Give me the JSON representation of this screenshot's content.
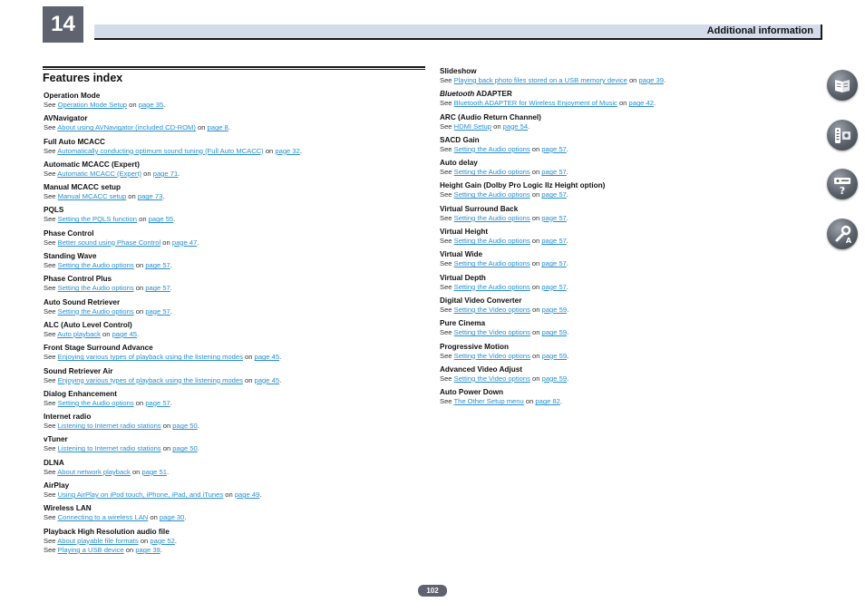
{
  "header": {
    "chapter": "14",
    "title": "Additional information"
  },
  "section_title": "Features index",
  "left_column": [
    {
      "title": "Operation Mode",
      "lines": [
        {
          "pre": "See ",
          "link": "Operation Mode Setup",
          "mid": " on ",
          "page": "page 35",
          "post": "."
        }
      ]
    },
    {
      "title": "AVNavigator",
      "lines": [
        {
          "pre": "See ",
          "link": "About using AVNavigator (included CD-ROM)",
          "mid": " on ",
          "page": "page 8",
          "post": "."
        }
      ]
    },
    {
      "title": "Full Auto MCACC",
      "lines": [
        {
          "pre": "See ",
          "link": "Automatically conducting optimum sound tuning (Full Auto MCACC)",
          "mid": " on ",
          "page": "page 32",
          "post": "."
        }
      ]
    },
    {
      "title": "Automatic MCACC (Expert)",
      "lines": [
        {
          "pre": "See ",
          "link": "Automatic MCACC (Expert)",
          "mid": " on ",
          "page": "page 71",
          "post": "."
        }
      ]
    },
    {
      "title": "Manual MCACC setup",
      "lines": [
        {
          "pre": "See ",
          "link": "Manual MCACC setup",
          "mid": " on ",
          "page": "page 73",
          "post": "."
        }
      ]
    },
    {
      "title": "PQLS",
      "lines": [
        {
          "pre": "See ",
          "link": "Setting the PQLS function",
          "mid": " on ",
          "page": "page 55",
          "post": "."
        }
      ]
    },
    {
      "title": "Phase Control",
      "lines": [
        {
          "pre": "See ",
          "link": "Better sound using Phase Control",
          "mid": " on ",
          "page": "page 47",
          "post": "."
        }
      ]
    },
    {
      "title": "Standing Wave",
      "lines": [
        {
          "pre": "See ",
          "link": "Setting the Audio options",
          "mid": " on ",
          "page": "page 57",
          "post": "."
        }
      ]
    },
    {
      "title": "Phase Control Plus",
      "lines": [
        {
          "pre": "See ",
          "link": "Setting the Audio options",
          "mid": " on ",
          "page": "page 57",
          "post": "."
        }
      ]
    },
    {
      "title": "Auto Sound Retriever",
      "lines": [
        {
          "pre": "See ",
          "link": "Setting the Audio options",
          "mid": " on ",
          "page": "page 57",
          "post": "."
        }
      ]
    },
    {
      "title": "ALC (Auto Level Control)",
      "lines": [
        {
          "pre": "See ",
          "link": "Auto playback",
          "mid": " on ",
          "page": "page 45",
          "post": "."
        }
      ]
    },
    {
      "title": "Front Stage Surround Advance",
      "lines": [
        {
          "pre": "See ",
          "link": "Enjoying various types of playback using the listening modes",
          "mid": " on ",
          "page": "page 45",
          "post": "."
        }
      ]
    },
    {
      "title": "Sound Retriever Air",
      "lines": [
        {
          "pre": "See ",
          "link": "Enjoying various types of playback using the listening modes",
          "mid": " on ",
          "page": "page 45",
          "post": "."
        }
      ]
    },
    {
      "title": "Dialog Enhancement",
      "lines": [
        {
          "pre": "See ",
          "link": "Setting the Audio options",
          "mid": " on ",
          "page": "page 57",
          "post": "."
        }
      ]
    },
    {
      "title": "Internet radio",
      "lines": [
        {
          "pre": "See ",
          "link": "Listening to Internet radio stations",
          "mid": " on ",
          "page": "page 50",
          "post": "."
        }
      ]
    },
    {
      "title": "vTuner",
      "lines": [
        {
          "pre": "See ",
          "link": "Listening to Internet radio stations",
          "mid": " on ",
          "page": "page 50",
          "post": "."
        }
      ]
    },
    {
      "title": "DLNA",
      "lines": [
        {
          "pre": "See ",
          "link": "About network playback",
          "mid": " on ",
          "page": "page 51",
          "post": "."
        }
      ]
    },
    {
      "title": "AirPlay",
      "lines": [
        {
          "pre": "See ",
          "link": "Using AirPlay on iPod touch, iPhone, iPad, and iTunes",
          "mid": " on ",
          "page": "page 49",
          "post": "."
        }
      ]
    },
    {
      "title": "Wireless LAN",
      "lines": [
        {
          "pre": "See ",
          "link": "Connecting to a wireless LAN",
          "mid": " on ",
          "page": "page 30",
          "post": "."
        }
      ]
    },
    {
      "title": "Playback High Resolution audio file",
      "lines": [
        {
          "pre": "See ",
          "link": "About playable file formats",
          "mid": " on ",
          "page": "page 52",
          "post": "."
        },
        {
          "pre": "See ",
          "link": "Playing a USB device",
          "mid": " on ",
          "page": "page 39",
          "post": "."
        }
      ]
    }
  ],
  "right_column": [
    {
      "title": "Slideshow",
      "lines": [
        {
          "pre": "See ",
          "link": "Playing back photo files stored on a USB memory device",
          "mid": " on ",
          "page": "page 39",
          "post": "."
        }
      ]
    },
    {
      "title_em": "Bluetooth",
      "title": " ADAPTER",
      "lines": [
        {
          "pre": "See ",
          "link": "Bluetooth ADAPTER for Wireless Enjoyment of Music",
          "mid": " on ",
          "page": "page 42",
          "post": "."
        }
      ]
    },
    {
      "title": "ARC (Audio Return Channel)",
      "lines": [
        {
          "pre": "See ",
          "link": "HDMI Setup",
          "mid": " on ",
          "page": "page 54",
          "post": "."
        }
      ]
    },
    {
      "title": "SACD Gain",
      "lines": [
        {
          "pre": "See ",
          "link": "Setting the Audio options",
          "mid": " on ",
          "page": "page 57",
          "post": "."
        }
      ]
    },
    {
      "title": "Auto delay",
      "lines": [
        {
          "pre": "See ",
          "link": "Setting the Audio options",
          "mid": " on ",
          "page": "page 57",
          "post": "."
        }
      ]
    },
    {
      "title": "Height Gain (Dolby Pro Logic llz Height option)",
      "lines": [
        {
          "pre": "See ",
          "link": "Setting the Audio options",
          "mid": " on ",
          "page": "page 57",
          "post": "."
        }
      ]
    },
    {
      "title": "Virtual Surround Back",
      "lines": [
        {
          "pre": "See ",
          "link": "Setting the Audio options",
          "mid": " on ",
          "page": "page 57",
          "post": "."
        }
      ]
    },
    {
      "title": "Virtual Height",
      "lines": [
        {
          "pre": "See ",
          "link": "Setting the Audio options",
          "mid": " on ",
          "page": "page 57",
          "post": "."
        }
      ]
    },
    {
      "title": "Virtual Wide",
      "lines": [
        {
          "pre": "See ",
          "link": "Setting the Audio options",
          "mid": " on ",
          "page": "page 57",
          "post": "."
        }
      ]
    },
    {
      "title": "Virtual Depth",
      "lines": [
        {
          "pre": "See ",
          "link": "Setting the Audio options",
          "mid": " on ",
          "page": "page 57",
          "post": "."
        }
      ]
    },
    {
      "title": "Digital Video Converter",
      "lines": [
        {
          "pre": "See ",
          "link": "Setting the Video options",
          "mid": " on ",
          "page": "page 59",
          "post": "."
        }
      ]
    },
    {
      "title": "Pure Cinema",
      "lines": [
        {
          "pre": "See ",
          "link": "Setting the Video options",
          "mid": " on ",
          "page": "page 59",
          "post": "."
        }
      ]
    },
    {
      "title": "Progressive Motion",
      "lines": [
        {
          "pre": "See ",
          "link": "Setting the Video options",
          "mid": " on ",
          "page": "page 59",
          "post": "."
        }
      ]
    },
    {
      "title": "Advanced Video Adjust",
      "lines": [
        {
          "pre": "See ",
          "link": "Setting the Video options",
          "mid": " on ",
          "page": "page 59",
          "post": "."
        }
      ]
    },
    {
      "title": "Auto Power Down",
      "lines": [
        {
          "pre": "See ",
          "link": "The Other Setup menu",
          "mid": " on ",
          "page": "page 82",
          "post": "."
        }
      ]
    }
  ],
  "side_icons": [
    "book-icon",
    "remote-icon",
    "receiver-question-icon",
    "wrench-icon"
  ],
  "colors": {
    "link": "#2a8fd0",
    "header_band": "#d4dceb",
    "chapter_box": "#5f6370"
  },
  "page_number": "102"
}
